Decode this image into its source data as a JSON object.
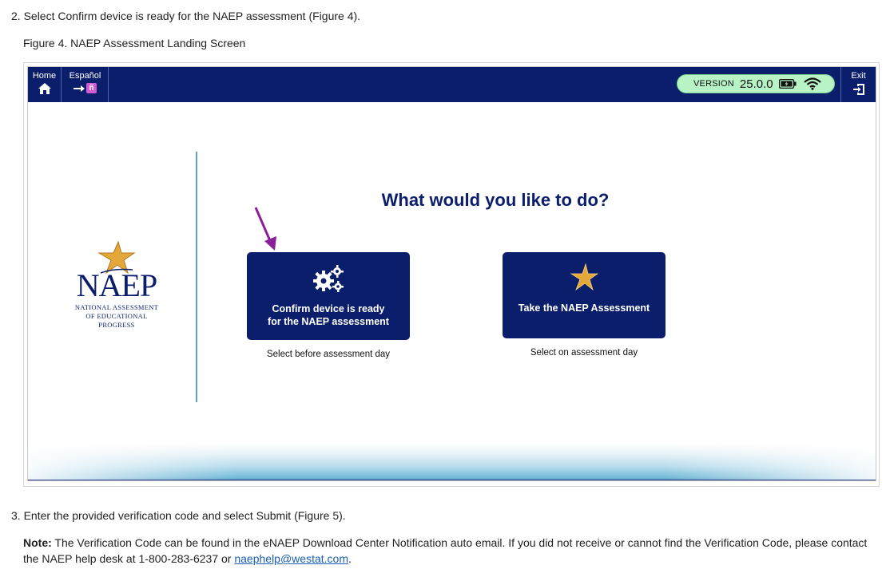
{
  "document": {
    "step2_text": "2. Select Confirm device is ready for the NAEP assessment (Figure 4).",
    "figure_caption": "Figure 4. NAEP Assessment Landing Screen",
    "step3_text": "3. Enter the provided verification code and select Submit (Figure 5).",
    "note_label": "Note:",
    "note_text": " The Verification Code can be found in the eNAEP Download Center Notification auto email. If you did not receive or cannot find the Verification Code, please contact the NAEP help desk at 1-800-283-6237 or ",
    "note_email": "naephelp@westat.com",
    "note_end": "."
  },
  "app": {
    "topbar": {
      "home_label": "Home",
      "home_icon": "home-icon",
      "espanol_label": "Español",
      "espanol_icon_letter": "ñ",
      "version_label": "VERSION",
      "version_number": "25.0.0",
      "exit_label": "Exit",
      "exit_icon": "exit-icon"
    },
    "logo": {
      "word": "NAEP",
      "subtitle": "NATIONAL ASSESSMENT OF EDUCATIONAL PROGRESS"
    },
    "question": "What would you like to do?",
    "buttons": [
      {
        "label_line1": "Confirm device is ready",
        "label_line2": "for the NAEP assessment",
        "icon": "gears-icon",
        "caption": "Select before assessment day"
      },
      {
        "label_line1": "Take the NAEP Assessment",
        "icon": "star-icon",
        "caption": "Select on assessment day"
      }
    ]
  },
  "colors": {
    "navy": "#0b1e6b",
    "version_pill": "#b7f3c4",
    "arrow": "#8b1f9a",
    "star_gold": "#e4a83a",
    "link": "#1a5fb4"
  }
}
